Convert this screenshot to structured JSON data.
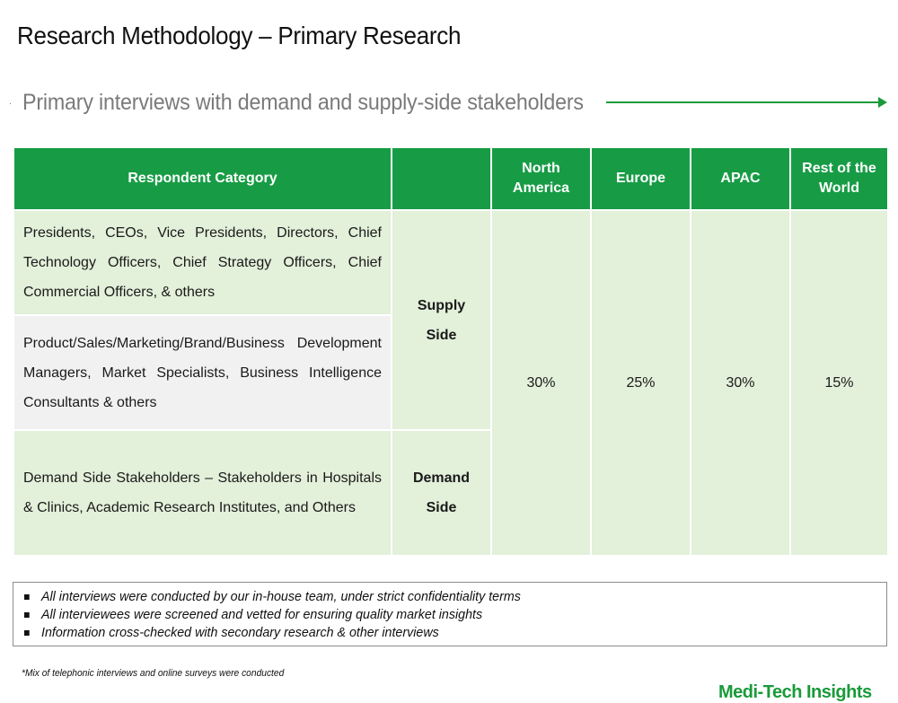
{
  "page": {
    "title": "Research Methodology – Primary Research",
    "subtitle": "Primary interviews with demand and supply-side stakeholders",
    "bullet_glyph": "·"
  },
  "colors": {
    "accent_green": "#179c45",
    "row_green": "#e3f0da",
    "row_grey": "#f1f1f1",
    "subtitle_grey": "#7a7a7a"
  },
  "table": {
    "headers": {
      "respondent": "Respondent Category",
      "side": "",
      "north_america": "North America",
      "europe": "Europe",
      "apac": "APAC",
      "rest_of_world": "Rest of the World"
    },
    "rows": [
      {
        "description": "Presidents, CEOs, Vice Presidents, Directors, Chief Technology Officers, Chief Strategy Officers, Chief Commercial Officers, & others"
      },
      {
        "description": "Product/Sales/Marketing/Brand/Business Development Managers, Market Specialists, Business Intelligence Consultants & others"
      },
      {
        "description": "Demand Side Stakeholders – Stakeholders in Hospitals & Clinics, Academic Research Institutes, and Others"
      }
    ],
    "sides": {
      "supply": "Supply Side",
      "demand": "Demand Side"
    },
    "shares": {
      "north_america": "30%",
      "europe": "25%",
      "apac": "30%",
      "rest_of_world": "15%"
    }
  },
  "notes": [
    "All interviews were conducted by our in-house team, under strict confidentiality terms",
    "All interviewees were screened and vetted for ensuring quality market insights",
    "Information cross-checked with secondary research & other interviews"
  ],
  "footnote": "*Mix of telephonic interviews and online surveys were conducted",
  "brand": "Medi-Tech Insights"
}
